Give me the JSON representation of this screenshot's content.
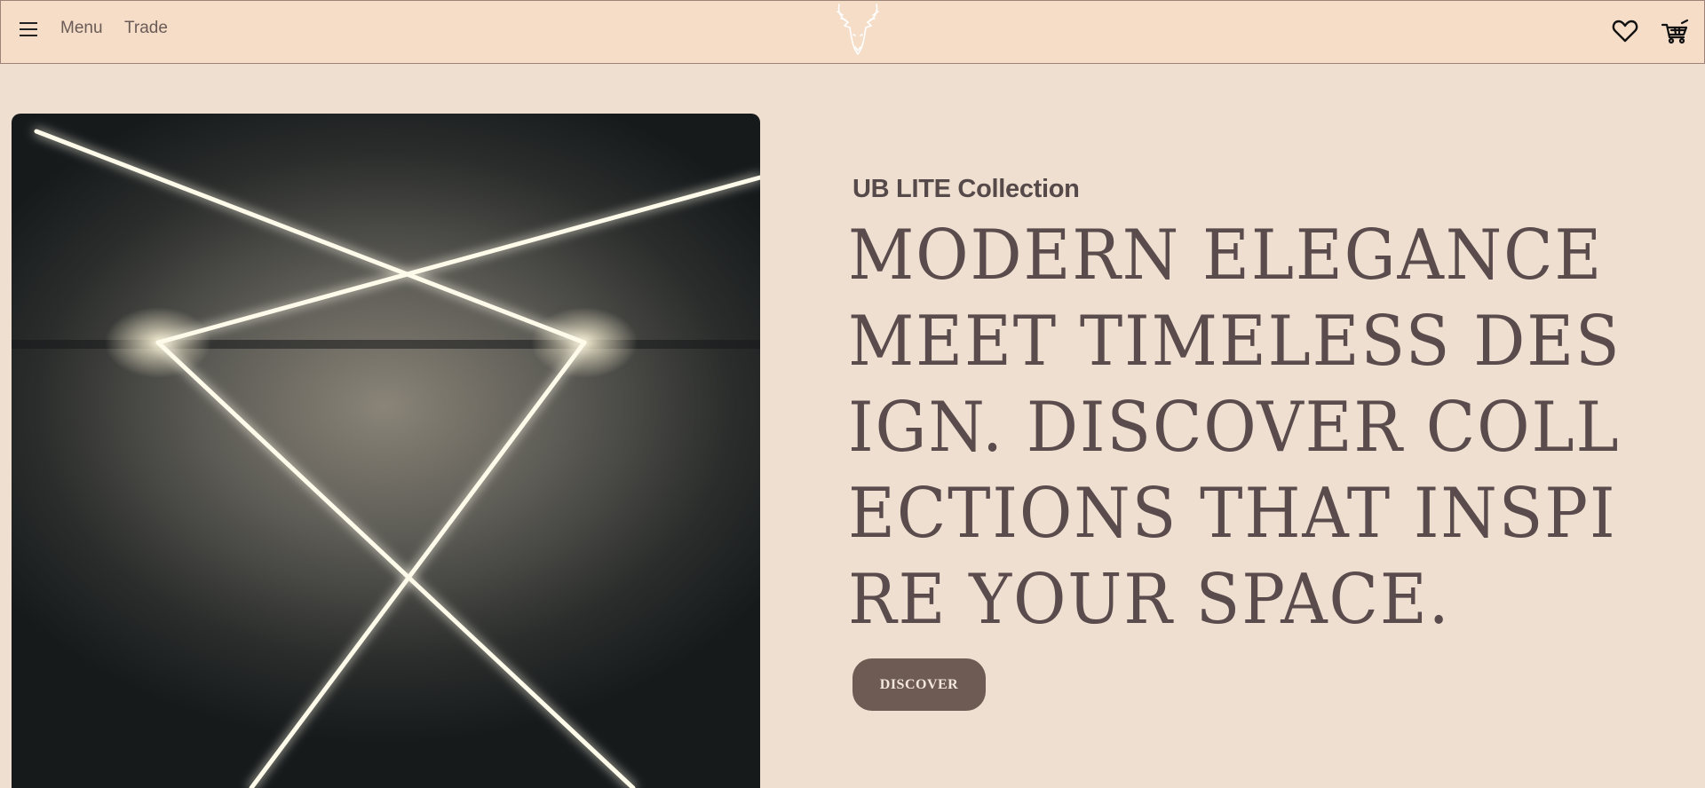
{
  "header": {
    "menu_label": "Menu",
    "trade_label": "Trade",
    "icons": {
      "menu": "hamburger-icon",
      "logo": "deer-head-logo",
      "wishlist": "heart-icon",
      "cart": "cart-icon"
    }
  },
  "hero": {
    "subtitle": "UB LITE Collection",
    "headline": "Modern elegance meet timeless design. Discover collections that inspire your space.",
    "cta_label": "DISCOVER",
    "image_subject": "crossing-light-lines"
  },
  "colors": {
    "header_bg": "#f5ddc8",
    "page_bg": "#efdfd0",
    "text": "#5a4b4d",
    "button_bg": "#6e5b54"
  }
}
